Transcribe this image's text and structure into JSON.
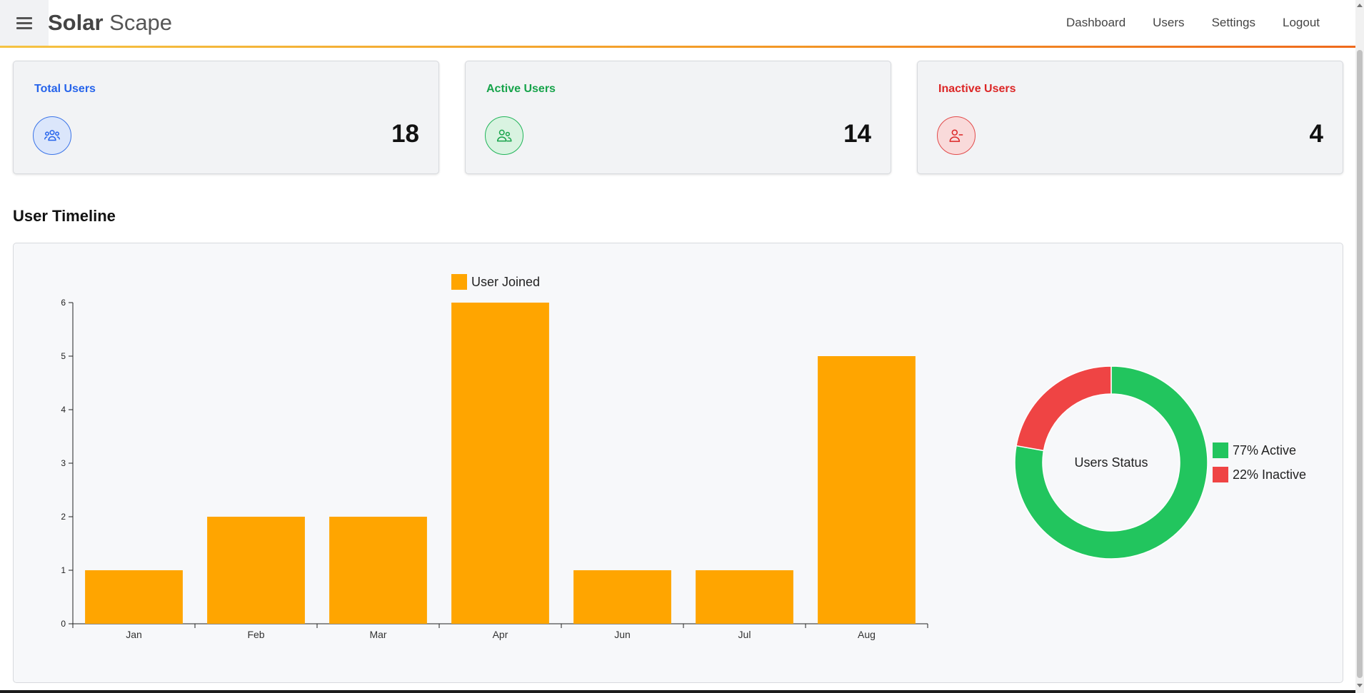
{
  "header": {
    "brand_strong": "Solar",
    "brand_rest": " Scape",
    "nav": [
      {
        "label": "Dashboard"
      },
      {
        "label": "Users"
      },
      {
        "label": "Settings"
      },
      {
        "label": "Logout"
      }
    ]
  },
  "cards": {
    "total": {
      "title": "Total Users",
      "value": "18",
      "icon": "users-group-icon"
    },
    "active": {
      "title": "Active Users",
      "value": "14",
      "icon": "users-icon"
    },
    "inactive": {
      "title": "Inactive Users",
      "value": "4",
      "icon": "user-minus-icon"
    }
  },
  "section_title": "User Timeline",
  "colors": {
    "bar": "#ffa500",
    "active": "#22c55e",
    "inactive": "#ef4444"
  },
  "chart_data": [
    {
      "type": "bar",
      "categories": [
        "Jan",
        "Feb",
        "Mar",
        "Apr",
        "Jun",
        "Jul",
        "Aug"
      ],
      "series": [
        {
          "name": "User Joined",
          "values": [
            1,
            2,
            2,
            6,
            1,
            1,
            5
          ]
        }
      ],
      "yticks": [
        "0",
        "1",
        "2",
        "3",
        "4",
        "5",
        "6"
      ],
      "ylim": [
        0,
        6
      ],
      "legend": "top"
    },
    {
      "type": "pie",
      "center_label": "Users Status",
      "slices": [
        {
          "label": "77% Active",
          "value": 77
        },
        {
          "label": "22% Inactive",
          "value": 22
        }
      ],
      "legend": "right"
    }
  ]
}
